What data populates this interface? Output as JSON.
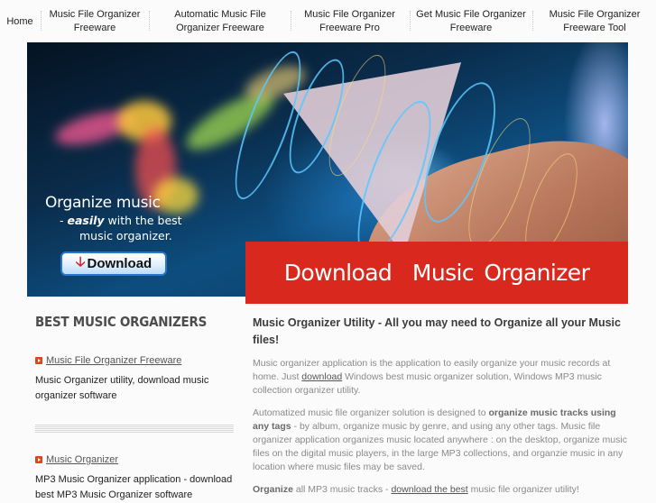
{
  "nav": {
    "items": [
      {
        "label": "Home"
      },
      {
        "label": "Music File Organizer Freeware"
      },
      {
        "label": "Automatic Music File Organizer Freeware"
      },
      {
        "label": "Music File Organizer Freeware Pro"
      },
      {
        "label": "Get Music File Organizer Freeware"
      },
      {
        "label": "Music File Organizer Freeware Tool"
      }
    ]
  },
  "banner": {
    "headline": "Organize music",
    "line2_prefix": "- ",
    "line2_em": "easily",
    "line2_suffix": " with the best",
    "line3": "music organizer.",
    "download_button": "Download",
    "cta": "Download  Music Organizer",
    "colors": {
      "cta_bg": "#d9281e",
      "button_border": "#2a74c9",
      "arrow": "#d2232a"
    }
  },
  "sidebar": {
    "title": "BEST MUSIC ORGANIZERS",
    "items": [
      {
        "link": "Music File Organizer Freeware",
        "desc": "Music Organizer utility, download music organizer software"
      },
      {
        "link": "Music Organizer",
        "desc": "MP3 Music Organizer application - download best MP3 Music Organizer software"
      }
    ],
    "icon": "play-bullet-icon",
    "accent": "#e0461e"
  },
  "main": {
    "title": "Music Organizer Utility - All you may need to Organize all your Music files!",
    "p1": {
      "before": "Music organizer application is the application to easily organize your music records at home. Just ",
      "link": "download",
      "after": " Windows best music organizer solution, Windows MP3 music collection organizer utility."
    },
    "p2": {
      "before": "Automatized music file organizer solution is designed to ",
      "bold": "organize music tracks using any tags",
      "after": " - by album, organize music by genre, and using any other tags. Music file organizer application organizes music located anywhere : on the desktop, organize music files on the digital music players, in the large MP3 collections, and organzie music in any location where music files may be saved."
    },
    "p3": {
      "bold": "Organize",
      "before": " all MP3 music tracks - ",
      "link": "download the best",
      "after": " music file organizer utility!"
    }
  }
}
